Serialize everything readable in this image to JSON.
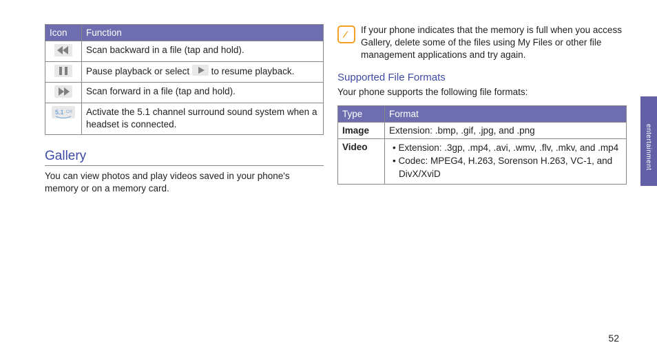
{
  "left": {
    "icon_table": {
      "headers": [
        "Icon",
        "Function"
      ],
      "rows": [
        {
          "icon_name": "scan-backward-icon",
          "func": "Scan backward in a file (tap and hold)."
        },
        {
          "icon_name": "pause-icon",
          "func_pre": "Pause playback or select ",
          "func_post": " to resume playback."
        },
        {
          "icon_name": "scan-forward-icon",
          "func": "Scan forward in a file (tap and hold)."
        },
        {
          "icon_name": "surround-51-icon",
          "func": "Activate the 5.1 channel surround sound system when a headset is connected."
        }
      ]
    },
    "gallery_heading": "Gallery",
    "gallery_text": "You can view photos and play videos saved in your phone's memory or on a memory card."
  },
  "right": {
    "note_text": "If your phone indicates that the memory is full when you access Gallery, delete some of the files using My Files or other file management applications and try again.",
    "supported_heading": "Supported File Formats",
    "supported_intro": "Your phone supports the following file formats:",
    "format_table": {
      "headers": [
        "Type",
        "Format"
      ],
      "rows": [
        {
          "type": "Image",
          "format": "Extension: .bmp, .gif, .jpg, and .png"
        },
        {
          "type": "Video",
          "bullets": [
            "Extension: .3gp, .mp4, .avi, .wmv, .flv, .mkv, and .mp4",
            "Codec: MPEG4, H.263, Sorenson H.263, VC-1, and DivX/XviD"
          ]
        }
      ]
    }
  },
  "side_tab": "entertainment",
  "page_number": "52"
}
